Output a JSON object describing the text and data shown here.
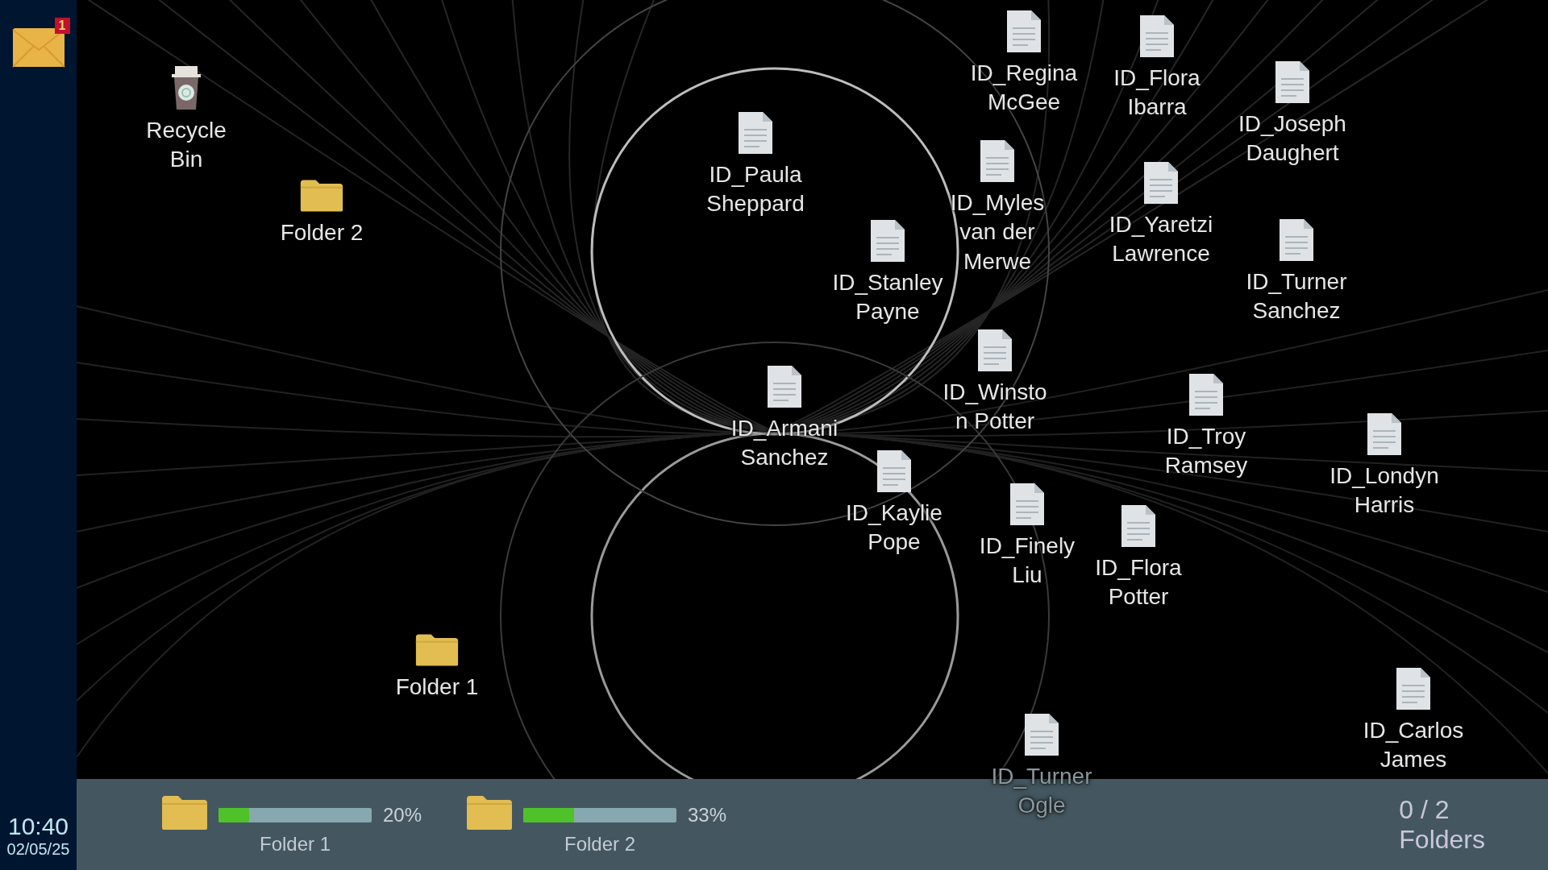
{
  "sidebar": {
    "mail": {
      "badge": "1"
    },
    "clock": {
      "time": "10:40",
      "date": "02/05/25"
    }
  },
  "desktop_icons": [
    {
      "kind": "document",
      "label": "ID_Regina McGee",
      "faded": false
    },
    {
      "kind": "document",
      "label": "ID_Flora Ibarra",
      "faded": false
    },
    {
      "kind": "recycle_bin",
      "label": "Recycle Bin",
      "faded": false
    },
    {
      "kind": "document",
      "label": "ID_Joseph Daughert",
      "faded": false
    },
    {
      "kind": "folder",
      "label": "Folder 2",
      "faded": false
    },
    {
      "kind": "document",
      "label": "ID_Paula Sheppard",
      "faded": false
    },
    {
      "kind": "document",
      "label": "ID_Myles van der Merwe",
      "faded": false
    },
    {
      "kind": "document",
      "label": "ID_Yaretzi Lawrence",
      "faded": false
    },
    {
      "kind": "document",
      "label": "ID_Stanley Payne",
      "faded": false
    },
    {
      "kind": "document",
      "label": "ID_Turner Sanchez",
      "faded": false
    },
    {
      "kind": "document",
      "label": "ID_Winston Potter",
      "faded": false
    },
    {
      "kind": "document",
      "label": "ID_Armani Sanchez",
      "faded": false
    },
    {
      "kind": "document",
      "label": "ID_Troy Ramsey",
      "faded": false
    },
    {
      "kind": "document",
      "label": "ID_Londyn Harris",
      "faded": false
    },
    {
      "kind": "document",
      "label": "ID_Kaylie Pope",
      "faded": false
    },
    {
      "kind": "document",
      "label": "ID_Finely Liu",
      "faded": false
    },
    {
      "kind": "document",
      "label": "ID_Flora Potter",
      "faded": false
    },
    {
      "kind": "folder",
      "label": "Folder 1",
      "faded": false
    },
    {
      "kind": "document",
      "label": "ID_Carlos James",
      "faded": false
    },
    {
      "kind": "document",
      "label": "ID_Turner Ogle",
      "faded": true
    }
  ],
  "taskbar": {
    "folders": [
      {
        "name": "Folder 1",
        "level": 0.2,
        "percent": "20%"
      },
      {
        "name": "Folder 2",
        "level": 0.33,
        "percent": "33%"
      }
    ],
    "counter": "0 / 2",
    "counter_label": "Folders"
  }
}
